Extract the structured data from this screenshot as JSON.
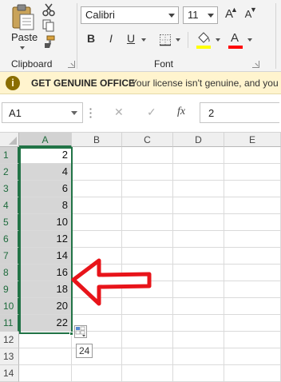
{
  "ribbon": {
    "clipboard": {
      "paste_label": "Paste",
      "group_label": "Clipboard",
      "icons": [
        "paste-icon",
        "cut-icon",
        "copy-icon",
        "format-painter-icon"
      ]
    },
    "font": {
      "font_name": "Calibri",
      "font_size": "11",
      "group_label": "Font",
      "bold": "B",
      "italic": "I",
      "underline": "U",
      "grow": "A",
      "shrink": "A",
      "font_color": "A",
      "fill_color": "#ffff00",
      "font_color_bar": "#ff0000"
    }
  },
  "warning": {
    "title": "GET GENUINE OFFICE",
    "message": "Your license isn't genuine, and you",
    "icon": "i"
  },
  "formula_bar": {
    "name_box": "A1",
    "cancel": "✕",
    "enter": "✓",
    "fx": "fx",
    "value": "2"
  },
  "sheet": {
    "columns": [
      "A",
      "B",
      "C",
      "D",
      "E"
    ],
    "rows": [
      "1",
      "2",
      "3",
      "4",
      "5",
      "6",
      "7",
      "8",
      "9",
      "10",
      "11",
      "12",
      "13",
      "14"
    ],
    "column_a_values": [
      "2",
      "4",
      "6",
      "8",
      "10",
      "12",
      "14",
      "16",
      "18",
      "20",
      "22"
    ],
    "autofill_tip": "24"
  },
  "colors": {
    "accent": "#217346",
    "arrow": "#e8141a",
    "warning_bg": "#fff4ce"
  }
}
